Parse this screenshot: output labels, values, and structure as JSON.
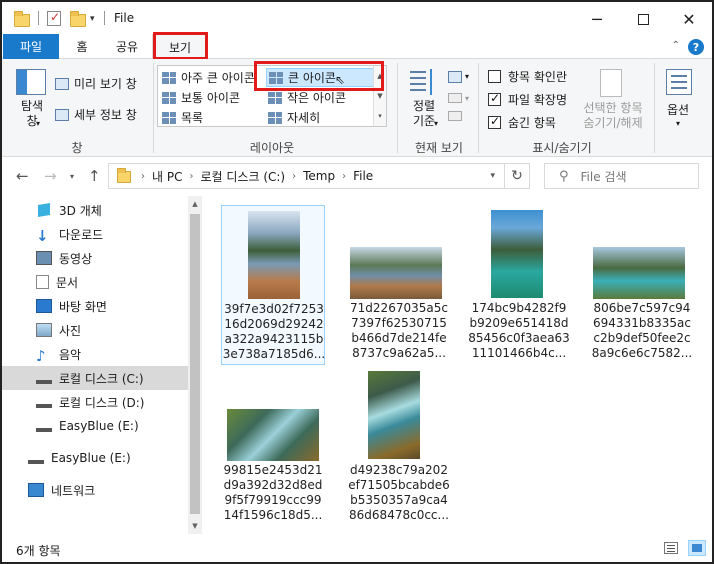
{
  "window": {
    "title": "File"
  },
  "tabs": [
    {
      "label": "파일"
    },
    {
      "label": "홈"
    },
    {
      "label": "공유"
    },
    {
      "label": "보기"
    }
  ],
  "ribbon": {
    "pane": {
      "nav_pane": "탐색 창",
      "preview": "미리 보기 창",
      "details": "세부 정보 창",
      "group": "창"
    },
    "layout": {
      "items": [
        "아주 큰 아이콘",
        "큰 아이콘",
        "보통 아이콘",
        "작은 아이콘",
        "목록",
        "자세히"
      ],
      "selected": "큰 아이콘",
      "group": "레이아웃"
    },
    "current_view": {
      "sort": "정렬 기준",
      "group": "현재 보기"
    },
    "show_hide": {
      "item_checkboxes": {
        "label": "항목 확인란",
        "checked": false
      },
      "file_ext": {
        "label": "파일 확장명",
        "checked": true
      },
      "hidden_items": {
        "label": "숨긴 항목",
        "checked": true
      },
      "hide_selected": "선택한 항목 숨기기/해제",
      "group": "표시/숨기기"
    },
    "options": "옵션"
  },
  "address": {
    "crumbs": [
      "내 PC",
      "로컬 디스크 (C:)",
      "Temp",
      "File"
    ],
    "search_placeholder": "File 검색"
  },
  "nav": {
    "items": [
      {
        "label": "3D 개체",
        "icon": "3d-objects-icon"
      },
      {
        "label": "다운로드",
        "icon": "download-icon"
      },
      {
        "label": "동영상",
        "icon": "video-icon"
      },
      {
        "label": "문서",
        "icon": "document-icon"
      },
      {
        "label": "바탕 화면",
        "icon": "desktop-icon"
      },
      {
        "label": "사진",
        "icon": "pictures-icon"
      },
      {
        "label": "음악",
        "icon": "music-icon"
      },
      {
        "label": "로컬 디스크 (C:)",
        "icon": "drive-icon",
        "selected": true
      },
      {
        "label": "로컬 디스크 (D:)",
        "icon": "drive-icon"
      },
      {
        "label": "EasyBlue (E:)",
        "icon": "drive-icon"
      },
      {
        "label": "EasyBlue (E:)",
        "icon": "drive-icon"
      },
      {
        "label": "네트워크",
        "icon": "network-icon"
      }
    ]
  },
  "files": [
    {
      "name": "39f7e3d02f7253 16d2069d29242 a322a9423115b 3e738a7185d6...",
      "selected": true
    },
    {
      "name": "71d2267035a5c 7397f62530715 b466d7de214fe 8737c9a62a5..."
    },
    {
      "name": "174bc9b4282f9 b9209e651418d 85456c0f3aea63 11101466b4c..."
    },
    {
      "name": "806be7c597c94 694331b8335ac c2b9def50fee2c 8a9c6e6c7582..."
    },
    {
      "name": "99815e2453d21 d9a392d32d8ed 9f5f79919ccc99 14f1596c18d5..."
    },
    {
      "name": "d49238c79a202 ef71505bcabde6 b5350357a9ca4 86d68478c0cc..."
    }
  ],
  "status": {
    "count": "6개 항목"
  },
  "colors": {
    "accent": "#1979ca",
    "highlight": "#e21a1a",
    "selection": "#cce8ff"
  }
}
